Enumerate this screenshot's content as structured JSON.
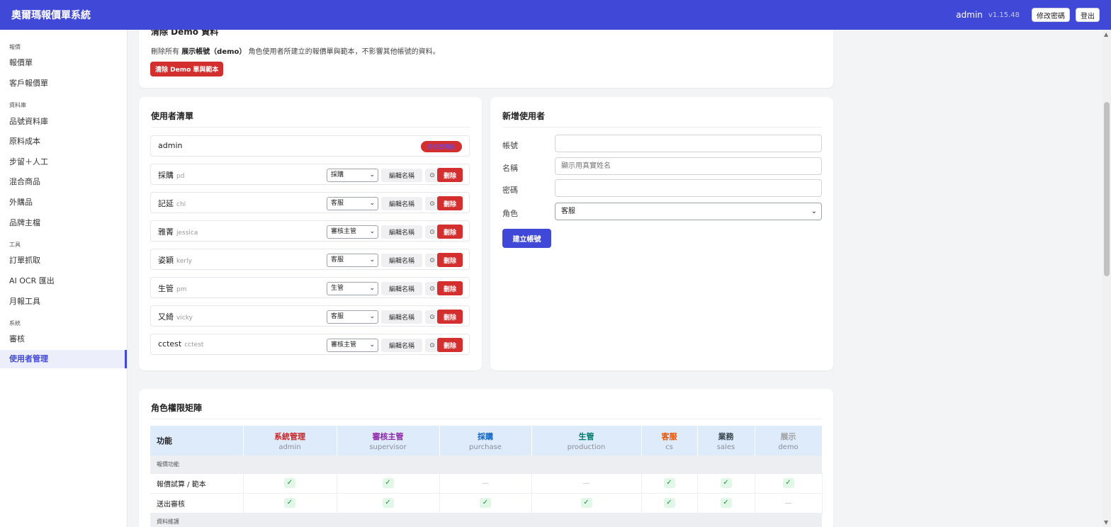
{
  "app": {
    "title": "奧爾瑪報價單系統",
    "user": "admin",
    "version": "v1.15.48",
    "change_password": "修改密碼",
    "logout": "登出"
  },
  "sidebar": {
    "sections": [
      {
        "label": "報價",
        "items": [
          {
            "label": "報價單"
          },
          {
            "label": "客戶報價單"
          }
        ]
      },
      {
        "label": "資料庫",
        "items": [
          {
            "label": "品號資料庫"
          },
          {
            "label": "原料成本"
          },
          {
            "label": "步留＋人工"
          },
          {
            "label": "混合商品"
          },
          {
            "label": "外購品"
          },
          {
            "label": "品牌主檔"
          }
        ]
      },
      {
        "label": "工具",
        "items": [
          {
            "label": "訂單抓取"
          },
          {
            "label": "AI OCR 匯出"
          },
          {
            "label": "月報工具"
          }
        ]
      },
      {
        "label": "系統",
        "items": [
          {
            "label": "審核"
          },
          {
            "label": "使用者管理",
            "active": true
          }
        ]
      }
    ]
  },
  "demo_card": {
    "title": "清除 Demo 資料",
    "desc_before": "刪除所有",
    "desc_bold": "展示帳號（demo）",
    "desc_after": "角色使用者所建立的報價單與範本，不影響其他帳號的資料。",
    "button": "清除 Demo 單與範本"
  },
  "users_card": {
    "title": "使用者清單",
    "admin_row": {
      "name": "admin",
      "badge": "系統管理員"
    },
    "edit_label": "編輯名稱",
    "clock_icon": "⊙",
    "delete_label": "刪除",
    "rows": [
      {
        "name": "採購",
        "account": "pd",
        "role": "採購"
      },
      {
        "name": "記延",
        "account": "chi",
        "role": "客服"
      },
      {
        "name": "雅菁",
        "account": "jessica",
        "role": "審核主管"
      },
      {
        "name": "姿穎",
        "account": "kerly",
        "role": "客服"
      },
      {
        "name": "生管",
        "account": "pm",
        "role": "生管"
      },
      {
        "name": "又綺",
        "account": "vicky",
        "role": "客服"
      },
      {
        "name": "cctest",
        "account": "cctest",
        "role": "審核主管"
      }
    ]
  },
  "new_user_card": {
    "title": "新增使用者",
    "account_label": "帳號",
    "name_label": "名稱",
    "name_placeholder": "顯示用真實姓名",
    "password_label": "密碼",
    "role_label": "角色",
    "role_value": "客服",
    "submit": "建立帳號"
  },
  "matrix_card": {
    "title": "角色權限矩陣",
    "feature_header": "功能",
    "roles": [
      {
        "name": "系統管理",
        "key": "admin",
        "color": "#c62828"
      },
      {
        "name": "審核主管",
        "key": "supervisor",
        "color": "#8e24aa"
      },
      {
        "name": "採購",
        "key": "purchase",
        "color": "#1565c0"
      },
      {
        "name": "生管",
        "key": "production",
        "color": "#00796b"
      },
      {
        "name": "客服",
        "key": "cs",
        "color": "#e65100"
      },
      {
        "name": "業務",
        "key": "sales",
        "color": "#37474f"
      },
      {
        "name": "展示",
        "key": "demo",
        "color": "#9e9e9e"
      }
    ],
    "check_symbol": "✓",
    "dash_symbol": "—",
    "sections": [
      {
        "label": "報價功能",
        "rows": [
          {
            "feature": "報價試算 / 範本",
            "perms": [
              true,
              true,
              false,
              false,
              true,
              true,
              true
            ]
          },
          {
            "feature": "送出審核",
            "perms": [
              true,
              true,
              true,
              true,
              true,
              true,
              false
            ]
          }
        ]
      },
      {
        "label": "資料維護",
        "rows": []
      }
    ]
  }
}
